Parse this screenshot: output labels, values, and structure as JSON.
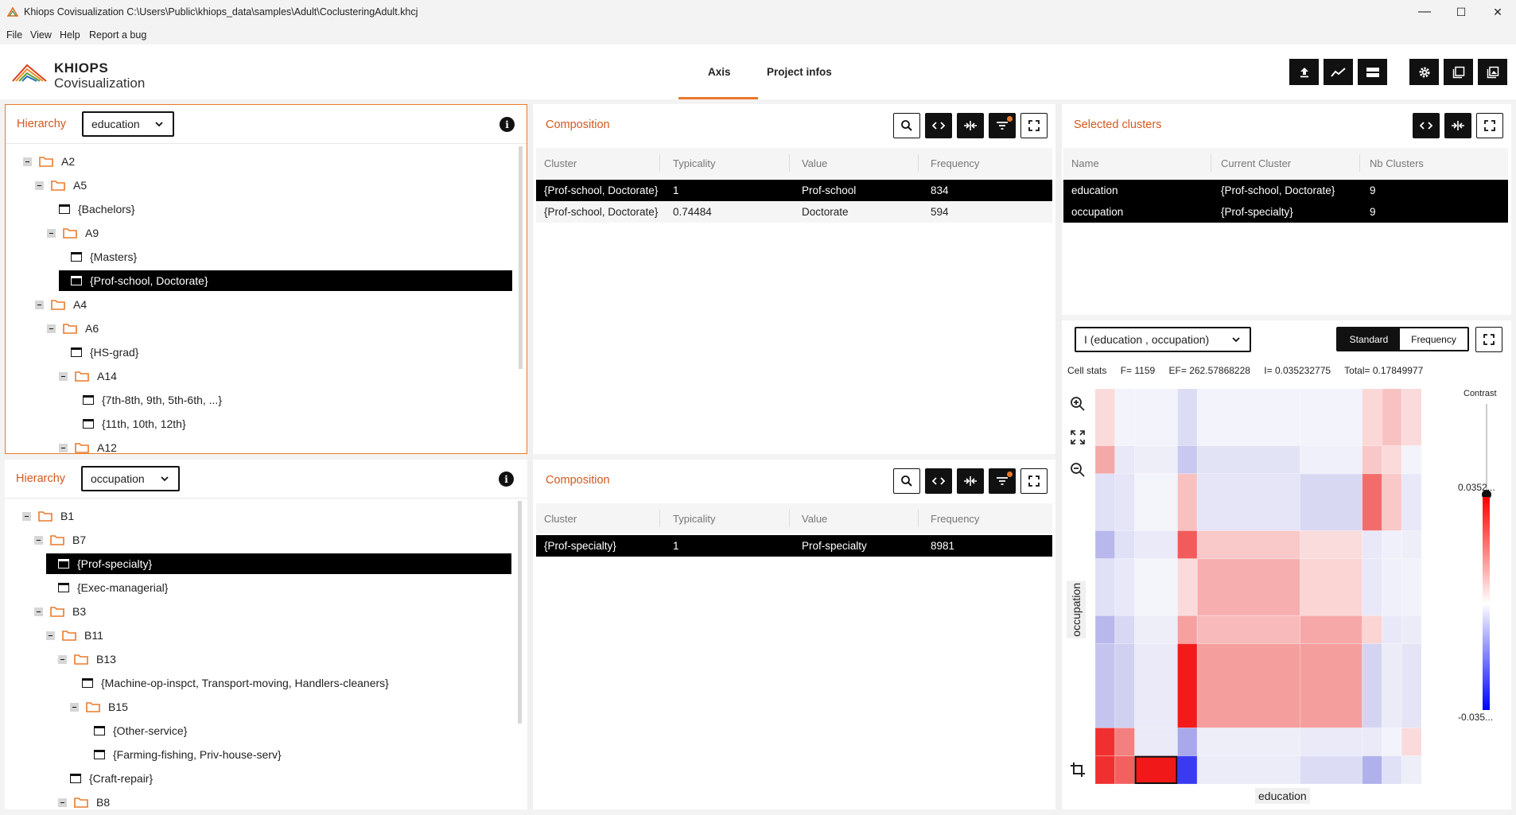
{
  "window": {
    "title": "Khiops Covisualization C:\\Users\\Public\\khiops_data\\samples\\Adult\\CoclusteringAdult.khcj",
    "minimize": "—",
    "maximize": "☐",
    "close": "✕"
  },
  "menu": [
    "File",
    "View",
    "Help",
    "Report a bug"
  ],
  "logo": {
    "line1": "KHIOPS",
    "line2": "Covisualization"
  },
  "tabs": [
    {
      "label": "Axis",
      "active": true
    },
    {
      "label": "Project infos",
      "active": false
    }
  ],
  "hierarchy1": {
    "title": "Hierarchy",
    "selected": "education",
    "nodes": [
      {
        "label": "A2",
        "type": "folder"
      },
      {
        "label": "A5",
        "type": "folder"
      },
      {
        "label": "{Bachelors}",
        "type": "leaf"
      },
      {
        "label": "A9",
        "type": "folder"
      },
      {
        "label": "{Masters}",
        "type": "leaf"
      },
      {
        "label": "{Prof-school, Doctorate}",
        "type": "leaf",
        "selected": true
      },
      {
        "label": "A4",
        "type": "folder"
      },
      {
        "label": "A6",
        "type": "folder"
      },
      {
        "label": "{HS-grad}",
        "type": "leaf"
      },
      {
        "label": "A14",
        "type": "folder"
      },
      {
        "label": "{7th-8th, 9th, 5th-6th, ...}",
        "type": "leaf"
      },
      {
        "label": "{11th, 10th, 12th}",
        "type": "leaf"
      },
      {
        "label": "A12",
        "type": "folder"
      }
    ]
  },
  "hierarchy2": {
    "title": "Hierarchy",
    "selected": "occupation",
    "nodes": [
      {
        "label": "B1",
        "type": "folder"
      },
      {
        "label": "B7",
        "type": "folder"
      },
      {
        "label": "{Prof-specialty}",
        "type": "leaf",
        "selected": true
      },
      {
        "label": "{Exec-managerial}",
        "type": "leaf"
      },
      {
        "label": "B3",
        "type": "folder"
      },
      {
        "label": "B11",
        "type": "folder"
      },
      {
        "label": "B13",
        "type": "folder"
      },
      {
        "label": "{Machine-op-inspct, Transport-moving, Handlers-cleaners}",
        "type": "leaf"
      },
      {
        "label": "B15",
        "type": "folder"
      },
      {
        "label": "{Other-service}",
        "type": "leaf"
      },
      {
        "label": "{Farming-fishing, Priv-house-serv}",
        "type": "leaf"
      },
      {
        "label": "{Craft-repair}",
        "type": "leaf"
      },
      {
        "label": "B8",
        "type": "folder"
      }
    ]
  },
  "composition1": {
    "title": "Composition",
    "columns": [
      "Cluster",
      "Typicality",
      "Value",
      "Frequency"
    ],
    "rows": [
      {
        "cluster": "{Prof-school, Doctorate}",
        "typicality": "1",
        "value": "Prof-school",
        "frequency": "834"
      },
      {
        "cluster": "{Prof-school, Doctorate}",
        "typicality": "0.74484",
        "value": "Doctorate",
        "frequency": "594"
      }
    ]
  },
  "composition2": {
    "title": "Composition",
    "columns": [
      "Cluster",
      "Typicality",
      "Value",
      "Frequency"
    ],
    "rows": [
      {
        "cluster": "{Prof-specialty}",
        "typicality": "1",
        "value": "Prof-specialty",
        "frequency": "8981"
      }
    ]
  },
  "selected_clusters": {
    "title": "Selected clusters",
    "columns": [
      "Name",
      "Current Cluster",
      "Nb Clusters"
    ],
    "rows": [
      {
        "name": "education",
        "current": "{Prof-school, Doctorate}",
        "nb": "9"
      },
      {
        "name": "occupation",
        "current": "{Prof-specialty}",
        "nb": "9"
      }
    ]
  },
  "matrix": {
    "select": "I (education , occupation)",
    "mode_standard": "Standard",
    "mode_frequency": "Frequency",
    "cell_stats_label": "Cell stats",
    "stat_f": "F= 1159",
    "stat_ef": "EF= 262.57868228",
    "stat_i": "I= 0.035232775",
    "stat_total": "Total= 0.17849977",
    "contrast_label": "Contrast",
    "contrast_level": 0.12,
    "legend_max": "0.0352...",
    "legend_min": "-0.035...",
    "x_label": "education",
    "y_label": "occupation",
    "x_proportions": [
      4.5,
      4.5,
      9.8,
      4.5,
      23.5,
      14.2,
      4.5,
      4.5,
      4.5
    ],
    "y_proportions": [
      14.2,
      7.0,
      14.2,
      7.0,
      14.2,
      7.0,
      21.0,
      7.0,
      7.0
    ],
    "selected_cell": [
      2,
      8
    ],
    "cells": [
      [
        "#fadada",
        "#f3f3fb",
        "#f3f3fb",
        "#dcdcf5",
        "#f3f3fb",
        "#f3f3fb",
        "#fbd8d8",
        "#f9c2c2",
        "#fadada"
      ],
      [
        "#f4a8a8",
        "#e8e8f8",
        "#eeeef9",
        "#c8c8f0",
        "#e3e3f6",
        "#f0f0fa",
        "#f8c8c8",
        "#fadada",
        "#f3f3fb"
      ],
      [
        "#e0e0f6",
        "#e5e5f7",
        "#f4f4fb",
        "#f9c0c0",
        "#e5e5f7",
        "#d8d8f3",
        "#f36c6c",
        "#f9c8c8",
        "#e8e8f8"
      ],
      [
        "#b8b8ec",
        "#e0e0f6",
        "#eaeaf8",
        "#f25b5b",
        "#f9c8c8",
        "#fbdcdc",
        "#e8e8f8",
        "#f0f0fa",
        "#eeeef9"
      ],
      [
        "#e0e0f6",
        "#e8e8f8",
        "#f4f4fb",
        "#fadada",
        "#f7aeae",
        "#fbd4d4",
        "#e8e8f8",
        "#f0f0fa",
        "#f2f2fa"
      ],
      [
        "#b8b8ec",
        "#d8d8f3",
        "#eeeef9",
        "#f6a0a0",
        "#f8baba",
        "#f6a8a8",
        "#fbd4d4",
        "#e8e8f8",
        "#ececf8"
      ],
      [
        "#c4c4ef",
        "#d0d0f1",
        "#eaeaf8",
        "#f31a1a",
        "#f59e9e",
        "#f59e9e",
        "#d4d4f2",
        "#ececf8",
        "#e4e4f6"
      ],
      [
        "#f03030",
        "#f28080",
        "#eaeaf8",
        "#a8a8ea",
        "#eeeef9",
        "#eaeaf8",
        "#eaeaf8",
        "#f3f3fb",
        "#fadada"
      ],
      [
        "#f03030",
        "#f26060",
        "#f01818",
        "#3a3af0",
        "#ececf8",
        "#dcdcf5",
        "#b0b0eb",
        "#e0e0f6",
        "#eeeef9"
      ]
    ]
  },
  "colors": {
    "accent": "#d2591e",
    "tab_underline": "#ea7a2a",
    "selection": "#000000",
    "heat_pos": "#ff0000",
    "heat_neg": "#0000ff"
  }
}
